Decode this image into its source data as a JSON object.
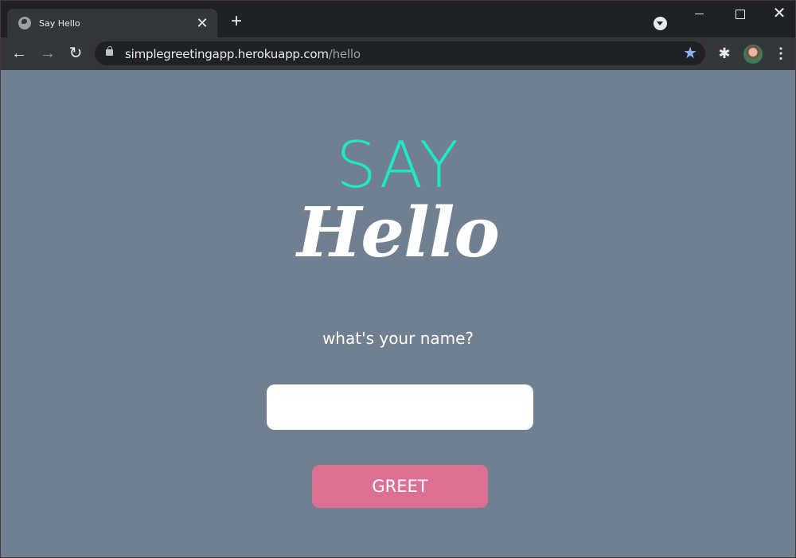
{
  "browser": {
    "tab_title": "Say Hello",
    "tab_close": "✕",
    "new_tab": "+",
    "url_host": "simplegreetingapp.herokuapp.com",
    "url_path": "/hello",
    "icons": {
      "favicon": "globe-icon",
      "back": "←",
      "forward": "→",
      "reload": "↻",
      "star": "★",
      "extensions": "✱",
      "menu": "⋮",
      "close": "✕"
    }
  },
  "page": {
    "background": "#708090",
    "logo_line1": "SAY",
    "logo_line2": "Hello",
    "logo_accent_color": "#1de9c5",
    "prompt": "what's your name?",
    "name_input_value": "",
    "greet_label": "GREET",
    "greet_color": "#db7093"
  }
}
